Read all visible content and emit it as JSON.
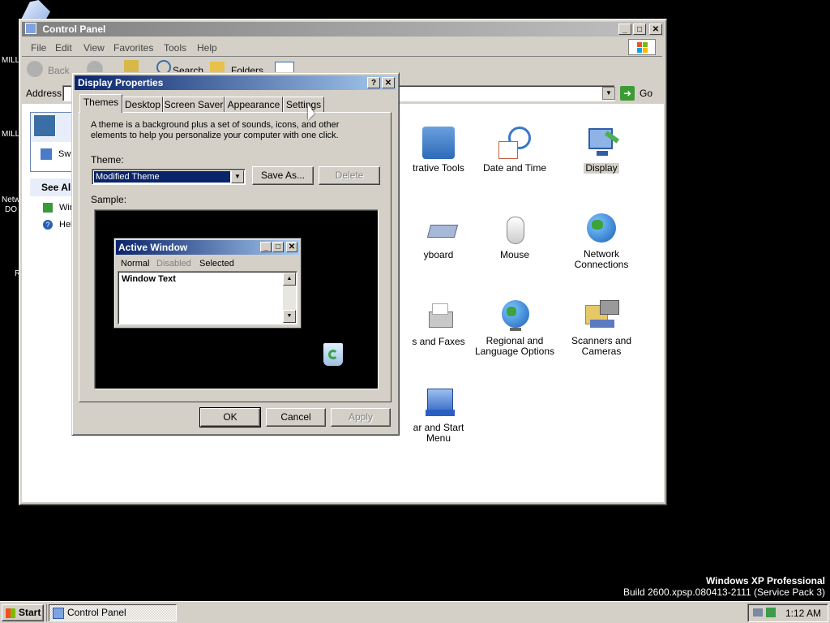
{
  "desktop": {
    "fragments": [
      "MILL",
      "MILL",
      "Netw",
      "DO",
      "R"
    ],
    "os_name": "Windows XP Professional",
    "build": "Build 2600.xpsp.080413-2111 (Service Pack 3)"
  },
  "control_panel": {
    "title": "Control Panel",
    "menu": [
      "File",
      "Edit",
      "View",
      "Favorites",
      "Tools",
      "Help"
    ],
    "toolbar": {
      "back": "Back",
      "search": "Search",
      "folders": "Folders"
    },
    "address_label": "Address",
    "go_label": "Go",
    "left_panel": {
      "switch_frag": "Sw",
      "see_also": "See Als",
      "item1": "Win",
      "item2": "Hel"
    },
    "icons": [
      {
        "name": "trative Tools"
      },
      {
        "name": "Date and Time"
      },
      {
        "name": "Display"
      },
      {
        "name": "yboard"
      },
      {
        "name": "Mouse"
      },
      {
        "name": "Network Connections"
      },
      {
        "name": "s and Faxes"
      },
      {
        "name": "Regional and Language Options"
      },
      {
        "name": "Scanners and Cameras"
      },
      {
        "name": "ar and Start Menu"
      }
    ]
  },
  "dialog": {
    "title": "Display Properties",
    "tabs": [
      "Themes",
      "Desktop",
      "Screen Saver",
      "Appearance",
      "Settings"
    ],
    "description": "A theme is a background plus a set of sounds, icons, and other elements to help you personalize your computer with one click.",
    "theme_label": "Theme:",
    "theme_value": "Modified Theme",
    "save_as": "Save As...",
    "delete": "Delete",
    "sample_label": "Sample:",
    "sample_window": {
      "title": "Active Window",
      "menu": [
        "Normal",
        "Disabled",
        "Selected"
      ],
      "text": "Window Text"
    },
    "buttons": {
      "ok": "OK",
      "cancel": "Cancel",
      "apply": "Apply"
    }
  },
  "taskbar": {
    "start": "Start",
    "task": "Control Panel",
    "clock": "1:12 AM"
  }
}
